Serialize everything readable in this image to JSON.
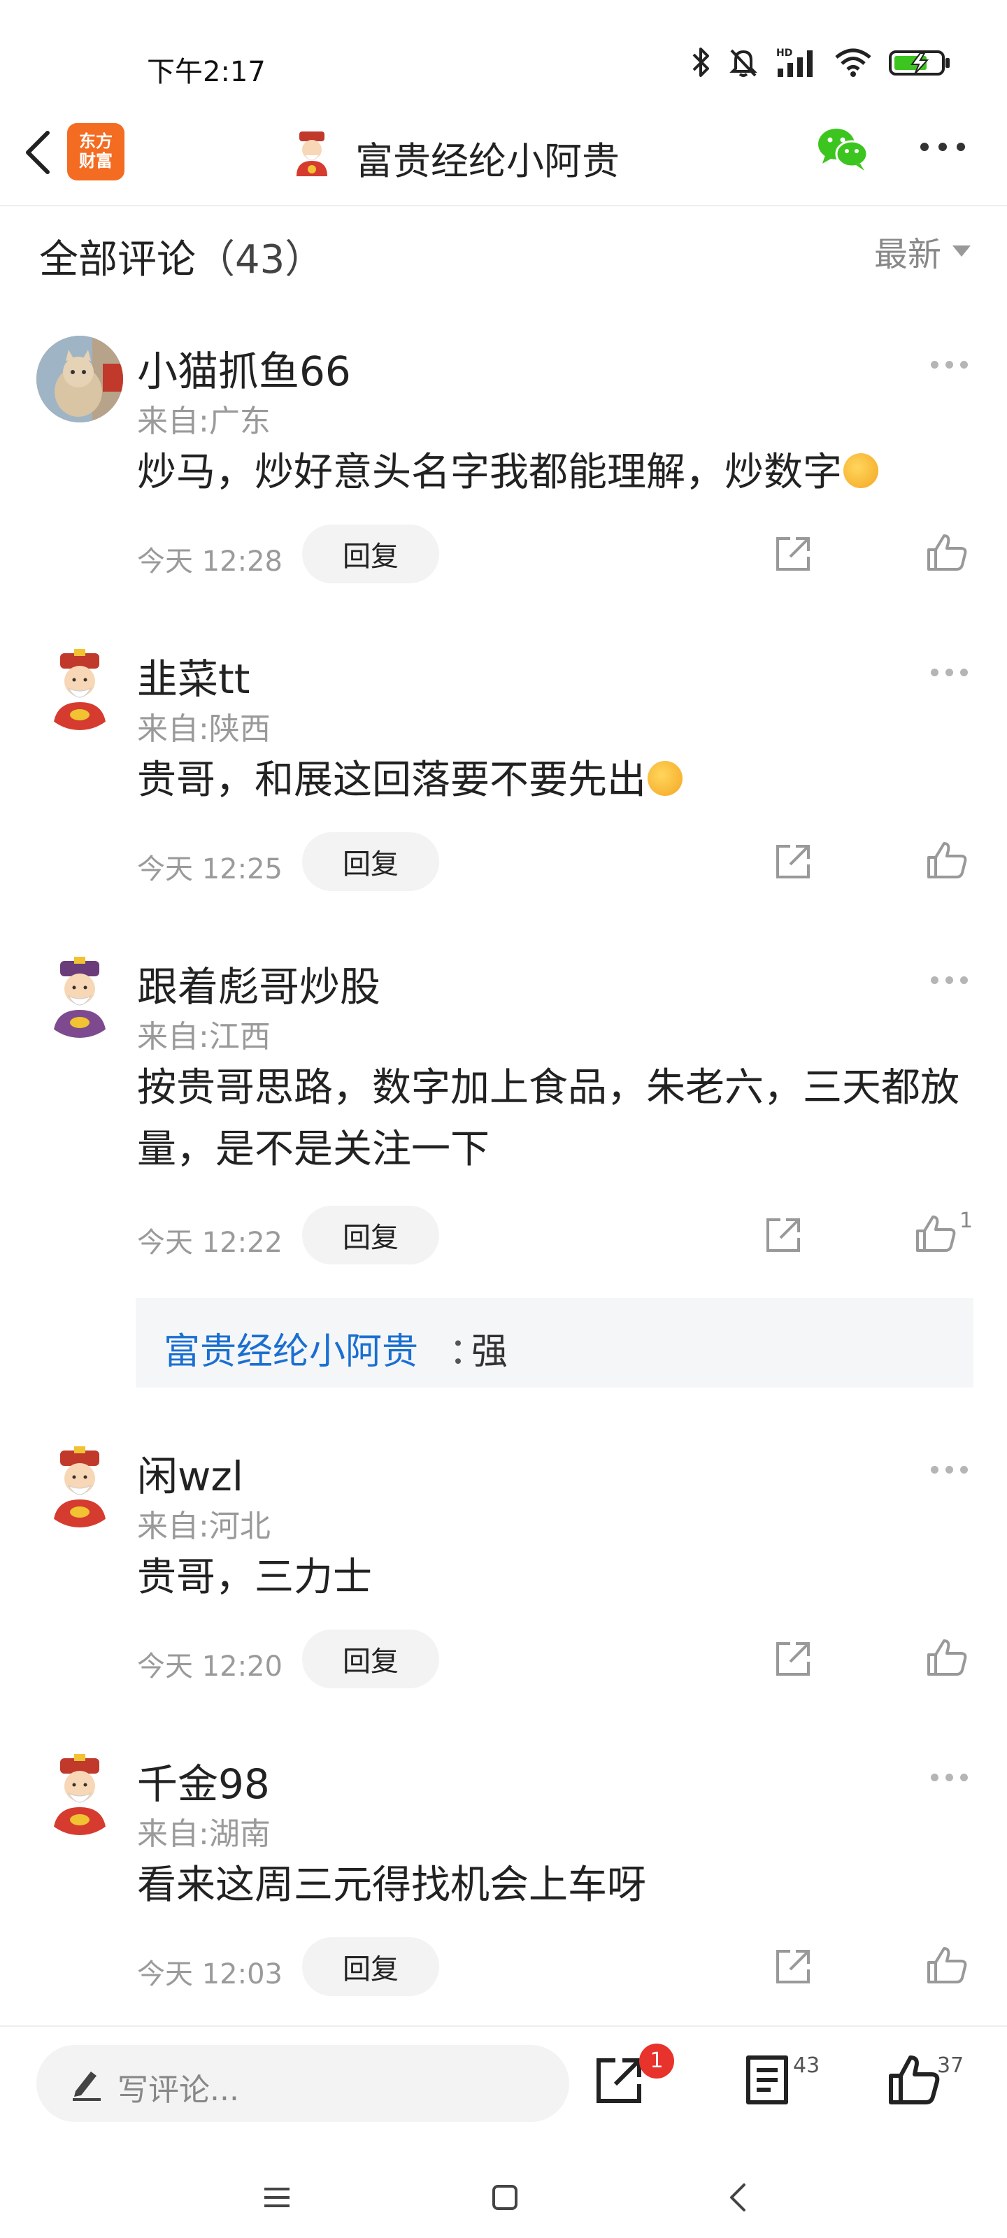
{
  "status_bar": {
    "time": "下午2:17",
    "hd_label": "HD"
  },
  "header": {
    "logo_line1": "东方",
    "logo_line2": "财富",
    "title": "富贵经纶小阿贵",
    "back_icon": "chevron-left-icon",
    "share_icon": "wechat-icon",
    "more_icon": "more-horizontal-icon"
  },
  "comments_section": {
    "title": "全部评论",
    "count": "（43）",
    "sort_label": "最新"
  },
  "comments": [
    {
      "username": "小猫抓鱼66",
      "location": "来自:广东",
      "text": "炒马，炒好意头名字我都能理解，炒数字",
      "emoji": "sweat-emoji",
      "time": "今天 12:28",
      "reply_label": "回复",
      "likes": ""
    },
    {
      "username": "韭菜tt",
      "location": "来自:陕西",
      "text": "贵哥，和展这回落要不要先出",
      "emoji": "laughing-emoji",
      "time": "今天 12:25",
      "reply_label": "回复",
      "likes": ""
    },
    {
      "username": "跟着彪哥炒股",
      "location": "来自:江西",
      "text_line1": "按贵哥思路，数字加上食品，朱老六，三天都放",
      "text_line2": "量，是不是关注一下",
      "time": "今天 12:22",
      "reply_label": "回复",
      "likes": "1",
      "reply": {
        "author": "富贵经纶小阿贵",
        "separator": "：",
        "text": "强"
      }
    },
    {
      "username": "闲wzl",
      "location": "来自:河北",
      "text": "贵哥，三力士",
      "time": "今天 12:20",
      "reply_label": "回复",
      "likes": ""
    },
    {
      "username": "千金98",
      "location": "来自:湖南",
      "text": "看来这周三元得找机会上车呀",
      "time": "今天 12:03",
      "reply_label": "回复",
      "likes": ""
    }
  ],
  "bottom_bar": {
    "input_placeholder": "写评论...",
    "share_badge": "1",
    "comment_count": "43",
    "like_count": "37"
  },
  "colors": {
    "accent_blue": "#1a6fd1",
    "logo_orange": "#f36c21",
    "badge_red": "#e8322c",
    "wechat_green": "#3cc51f"
  }
}
